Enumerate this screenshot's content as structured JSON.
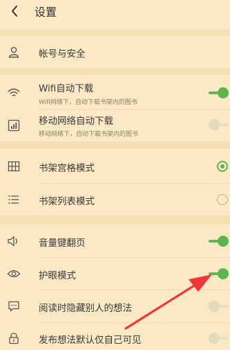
{
  "header": {
    "title": "设置",
    "back_icon": "chevron-left-icon"
  },
  "account": {
    "label": "帐号与安全",
    "icon": "user-icon"
  },
  "download": {
    "wifi": {
      "label": "Wifi自动下载",
      "sub": "Wifi网络下，自动下载书架内的图书",
      "enabled": true,
      "icon": "wifi-icon"
    },
    "mobile": {
      "label": "移动网络自动下载",
      "sub": "移动网络下，自动下载书架内的图书",
      "enabled": false,
      "icon": "signal-icon"
    }
  },
  "shelf": {
    "grid": {
      "label": "书架宫格模式",
      "selected": true,
      "icon": "grid-icon"
    },
    "list": {
      "label": "书架列表模式",
      "selected": false,
      "icon": "list-icon"
    }
  },
  "reading": {
    "volume": {
      "label": "音量键翻页",
      "enabled": true,
      "icon": "speaker-icon"
    },
    "eye": {
      "label": "护眼模式",
      "enabled": true,
      "icon": "eye-icon"
    },
    "hide_thoughts": {
      "label": "阅读时隐藏别人的想法",
      "enabled": false,
      "icon": "comment-icon"
    },
    "private_thoughts": {
      "label": "发布想法默认仅自己可见",
      "enabled": false,
      "icon": "lock-icon"
    }
  },
  "colors": {
    "background": "#FBE8C4",
    "separator": "#F6DFB4",
    "accent": "#5BB54C",
    "annotation_arrow": "#F0353B"
  }
}
